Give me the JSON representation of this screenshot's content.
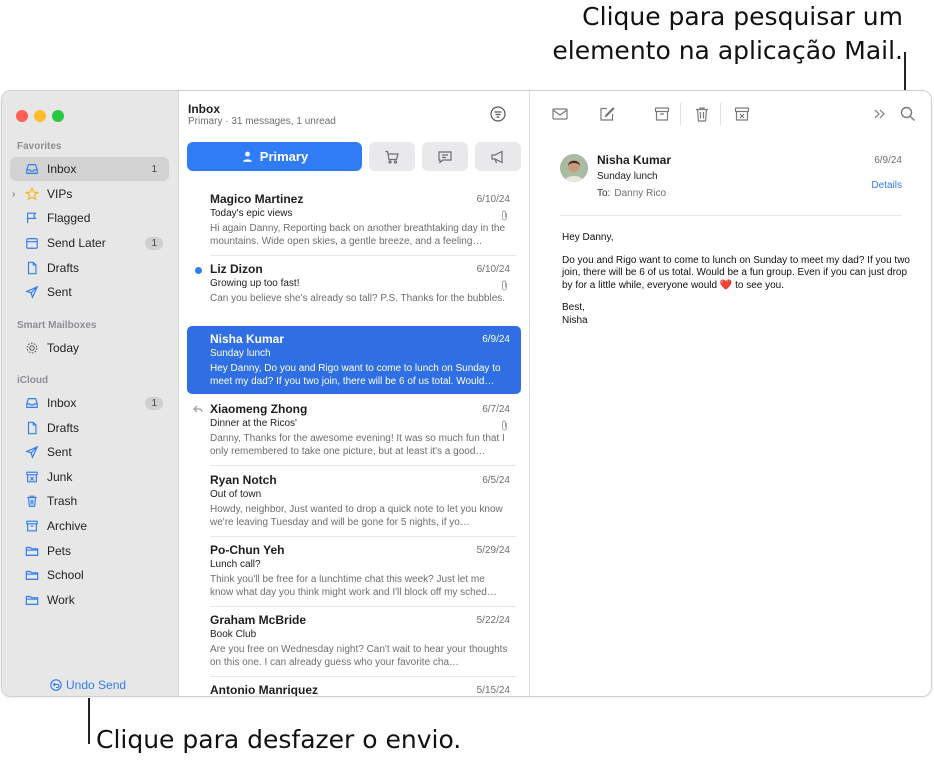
{
  "callouts": {
    "search_line1": "Clique para pesquisar um",
    "search_line2": "elemento na aplicação Mail.",
    "undo": "Clique para desfazer o envio."
  },
  "sidebar": {
    "favorites_header": "Favorites",
    "favorites": [
      {
        "label": "Inbox",
        "icon": "inbox-icon",
        "badge": "1",
        "selected": true
      },
      {
        "label": "VIPs",
        "icon": "star-icon"
      },
      {
        "label": "Flagged",
        "icon": "flag-icon"
      },
      {
        "label": "Send Later",
        "icon": "calendar-icon",
        "badge": "1"
      },
      {
        "label": "Drafts",
        "icon": "document-icon"
      },
      {
        "label": "Sent",
        "icon": "paperplane-icon"
      }
    ],
    "smart_header": "Smart Mailboxes",
    "smart": [
      {
        "label": "Today",
        "icon": "gear-icon"
      }
    ],
    "icloud_header": "iCloud",
    "icloud": [
      {
        "label": "Inbox",
        "icon": "inbox-icon",
        "badge": "1"
      },
      {
        "label": "Drafts",
        "icon": "document-icon"
      },
      {
        "label": "Sent",
        "icon": "paperplane-icon"
      },
      {
        "label": "Junk",
        "icon": "junk-icon"
      },
      {
        "label": "Trash",
        "icon": "trash-icon"
      },
      {
        "label": "Archive",
        "icon": "archive-icon"
      },
      {
        "label": "Pets",
        "icon": "folder-icon"
      },
      {
        "label": "School",
        "icon": "folder-icon"
      },
      {
        "label": "Work",
        "icon": "folder-icon"
      }
    ],
    "undo_send": "Undo Send"
  },
  "list": {
    "title": "Inbox",
    "subtitle": "Primary · 31 messages, 1 unread",
    "primary_tab": "Primary",
    "messages": [
      {
        "from": "Magico Martinez",
        "date": "6/10/24",
        "subject": "Today's epic views",
        "preview": "Hi again Danny, Reporting back on another breathtaking day in the mountains. Wide open skies, a gentle breeze, and a feeling…",
        "attachment": true
      },
      {
        "from": "Liz Dizon",
        "date": "6/10/24",
        "subject": "Growing up too fast!",
        "preview": "Can you believe she's already so tall? P.S. Thanks for the bubbles.",
        "attachment": true,
        "unread": true
      },
      {
        "from": "Nisha Kumar",
        "date": "6/9/24",
        "subject": "Sunday lunch",
        "preview": "Hey Danny, Do you and Rigo want to come to lunch on Sunday to meet my dad? If you two join, there will be 6 of us total. Would…",
        "selected": true
      },
      {
        "from": "Xiaomeng Zhong",
        "date": "6/7/24",
        "subject": "Dinner at the Ricos'",
        "preview": "Danny, Thanks for the awesome evening! It was so much fun that I only remembered to take one picture, but at least it's a good…",
        "attachment": true,
        "replied": true
      },
      {
        "from": "Ryan Notch",
        "date": "6/5/24",
        "subject": "Out of town",
        "preview": "Howdy, neighbor, Just wanted to drop a quick note to let you know we're leaving Tuesday and will be gone for 5 nights, if yo…"
      },
      {
        "from": "Po-Chun Yeh",
        "date": "5/29/24",
        "subject": "Lunch call?",
        "preview": "Think you'll be free for a lunchtime chat this week? Just let me know what day you think might work and I'll block off my sched…"
      },
      {
        "from": "Graham McBride",
        "date": "5/22/24",
        "subject": "Book Club",
        "preview": "Are you free on Wednesday night? Can't wait to hear your thoughts on this one. I can already guess who your favorite cha…"
      },
      {
        "from": "Antonio Manriquez",
        "date": "5/15/24",
        "subject": "",
        "preview": ""
      }
    ]
  },
  "reader": {
    "from": "Nisha Kumar",
    "date": "6/9/24",
    "subject": "Sunday lunch",
    "to_label": "To:",
    "to_name": "Danny Rico",
    "details": "Details",
    "greeting": "Hey Danny,",
    "body_part1": "Do you and Rigo want to come to lunch on Sunday to meet my dad? If you two join, there will be 6 of us total. Would be a fun group. Even if you can just drop by for a little while, everyone would",
    "heart": "❤️",
    "body_part2": "to see you.",
    "signoff1": "Best,",
    "signoff2": "Nisha"
  },
  "colors": {
    "accent": "#2f7cf6",
    "selected_row": "#2f6fe3"
  }
}
